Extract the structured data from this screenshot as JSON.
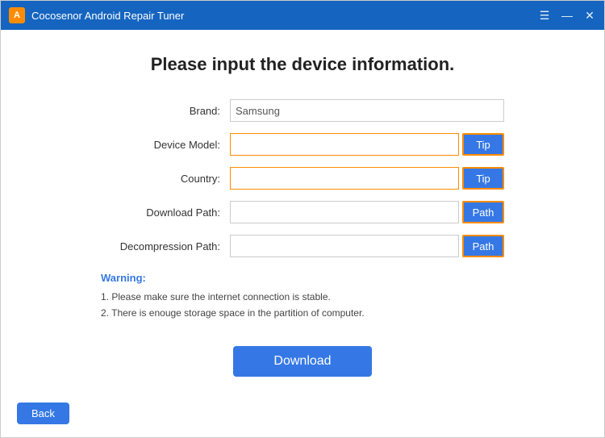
{
  "titleBar": {
    "icon": "A",
    "title": "Cocosenor Android Repair Tuner",
    "minimize": "—",
    "maximize": "□",
    "close": "✕"
  },
  "pageTitle": "Please input the device information.",
  "form": {
    "brandLabel": "Brand:",
    "brandValue": "Samsung",
    "deviceModelLabel": "Device Model:",
    "deviceModelValue": "",
    "deviceModelTip": "Tip",
    "countryLabel": "Country:",
    "countryValue": "",
    "countryTip": "Tip",
    "downloadPathLabel": "Download Path:",
    "downloadPathValue": "",
    "downloadPathBtn": "Path",
    "decompressionPathLabel": "Decompression Path:",
    "decompressionPathValue": "",
    "decompressionPathBtn": "Path"
  },
  "warning": {
    "title": "Warning:",
    "line1": "1. Please make sure the internet connection is stable.",
    "line2": "2. There is enouge storage space in the partition of computer."
  },
  "buttons": {
    "download": "Download",
    "back": "Back"
  }
}
